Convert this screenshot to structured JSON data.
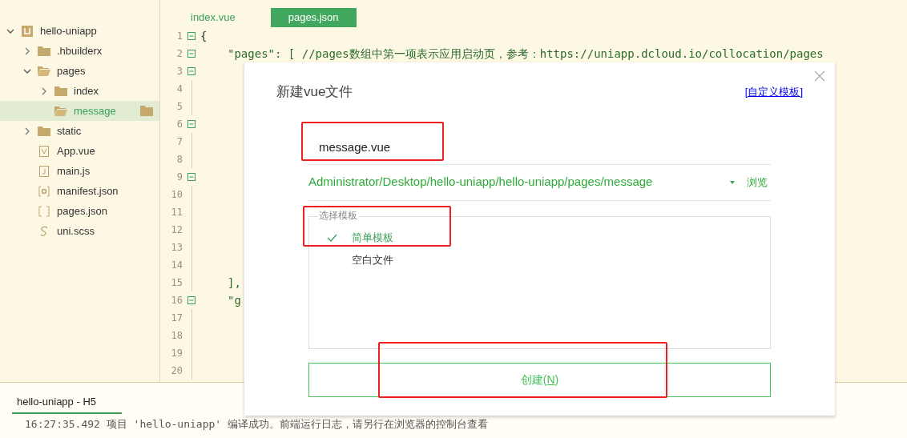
{
  "project_tree": [
    {
      "label": "hello-uniapp",
      "kind": "project",
      "expanded": true,
      "selected": false,
      "children": [
        {
          "label": ".hbuilderx",
          "kind": "folder",
          "expanded": false,
          "selected": false
        },
        {
          "label": "pages",
          "kind": "folder",
          "expanded": true,
          "selected": false,
          "children": [
            {
              "label": "index",
              "kind": "folder",
              "expanded": false,
              "selected": false
            },
            {
              "label": "message",
              "kind": "folder",
              "expanded": true,
              "selected": true
            }
          ]
        },
        {
          "label": "static",
          "kind": "folder",
          "expanded": false,
          "selected": false
        },
        {
          "label": "App.vue",
          "kind": "vue",
          "selected": false
        },
        {
          "label": "main.js",
          "kind": "js",
          "selected": false
        },
        {
          "label": "manifest.json",
          "kind": "manifest",
          "selected": false
        },
        {
          "label": "pages.json",
          "kind": "json",
          "selected": false
        },
        {
          "label": "uni.scss",
          "kind": "scss",
          "selected": false
        }
      ]
    }
  ],
  "editor_tabs": [
    {
      "label": "index.vue",
      "selected": false
    },
    {
      "label": "pages.json",
      "selected": true
    }
  ],
  "code_lines": [
    {
      "number": "1",
      "fold": true,
      "text": "{"
    },
    {
      "number": "2",
      "fold": true,
      "text": "\"pages\": [ //pages数组中第一项表示应用启动页，参考：https://uniapp.dcloud.io/collocation/pages"
    },
    {
      "number": "3",
      "fold": true
    },
    {
      "number": "4",
      "fold": false
    },
    {
      "number": "5",
      "fold": false
    },
    {
      "number": "6",
      "fold": true
    },
    {
      "number": "7",
      "fold": false
    },
    {
      "number": "8",
      "fold": false
    },
    {
      "number": "9",
      "fold": true
    },
    {
      "number": "10",
      "fold": false
    },
    {
      "number": "11",
      "fold": false
    },
    {
      "number": "12",
      "fold": false
    },
    {
      "number": "13",
      "fold": false
    },
    {
      "number": "14",
      "fold": false
    },
    {
      "number": "15",
      "fold": false,
      "text": "],"
    },
    {
      "number": "16",
      "fold": true,
      "text": "\"g"
    },
    {
      "number": "17",
      "fold": false
    },
    {
      "number": "18",
      "fold": false
    },
    {
      "number": "19",
      "fold": false
    },
    {
      "number": "20",
      "fold": false
    }
  ],
  "dialog": {
    "title": "新建vue文件",
    "template_link": "[自定义模板]",
    "filename": "message.vue",
    "path": "Administrator/Desktop/hello-uniapp/hello-uniapp/pages/message",
    "browse": "浏览",
    "template_group": {
      "legend": "选择模板",
      "options": [
        {
          "label": "简单模板",
          "selected": true
        },
        {
          "label": "空白文件",
          "selected": false
        }
      ]
    },
    "create_button": {
      "before": "创建(",
      "key": "N",
      "after": ")"
    }
  },
  "console": {
    "tab": "hello-uniapp - H5",
    "log": "16:27:35.492 项目 'hello-uniapp' 编译成功。前端运行日志，请另行在浏览器的控制台查看"
  }
}
